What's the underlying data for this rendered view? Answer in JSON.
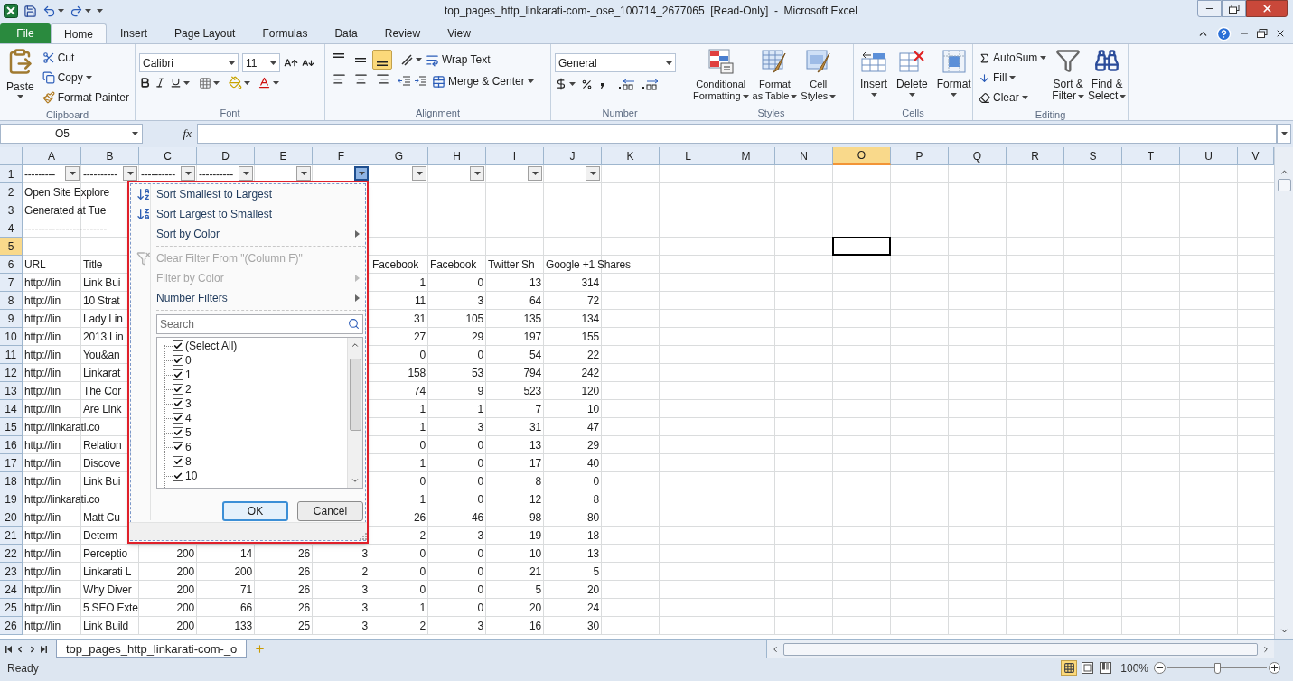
{
  "window": {
    "title": "top_pages_http_linkarati-com-_ose_100714_2677065  [Read-Only]  -  Microsoft Excel"
  },
  "ribbon_tabs": [
    {
      "label": "File",
      "kind": "file",
      "selected": false
    },
    {
      "label": "Home",
      "kind": "tab",
      "selected": true
    },
    {
      "label": "Insert",
      "kind": "tab",
      "selected": false
    },
    {
      "label": "Page Layout",
      "kind": "tab",
      "selected": false
    },
    {
      "label": "Formulas",
      "kind": "tab",
      "selected": false
    },
    {
      "label": "Data",
      "kind": "tab",
      "selected": false
    },
    {
      "label": "Review",
      "kind": "tab",
      "selected": false
    },
    {
      "label": "View",
      "kind": "tab",
      "selected": false
    }
  ],
  "clipboard": {
    "label": "Clipboard",
    "paste": "Paste",
    "cut": "Cut",
    "copy": "Copy",
    "format_painter": "Format Painter"
  },
  "font": {
    "label": "Font",
    "name": "Calibri",
    "size": "11"
  },
  "alignment": {
    "label": "Alignment",
    "wrap_text": "Wrap Text",
    "merge": "Merge & Center",
    "vertical_align": [
      {
        "selected": false
      },
      {
        "selected": false
      },
      {
        "selected": true
      }
    ]
  },
  "number": {
    "label": "Number",
    "format": "General"
  },
  "styles": {
    "label": "Styles",
    "buttons": [
      {
        "lines": [
          "Conditional",
          "Formatting"
        ],
        "kind": "conditional"
      },
      {
        "lines": [
          "Format",
          "as Table"
        ],
        "kind": "table"
      },
      {
        "lines": [
          "Cell",
          "Styles"
        ],
        "kind": "cell"
      }
    ]
  },
  "cells": {
    "label": "Cells",
    "buttons": [
      {
        "label": "Insert",
        "kind": "insert"
      },
      {
        "label": "Delete",
        "kind": "delete"
      },
      {
        "label": "Format",
        "kind": "format"
      }
    ]
  },
  "editing": {
    "label": "Editing",
    "autosum": "AutoSum",
    "fill": "Fill",
    "clear": "Clear",
    "sort": [
      "Sort &",
      "Filter"
    ],
    "find": [
      "Find &",
      "Select"
    ]
  },
  "formula_bar": {
    "name_box": "O5",
    "function_label": "fx"
  },
  "columns": [
    {
      "label": "A",
      "selected": false,
      "filter": true,
      "filter_active": false
    },
    {
      "label": "B",
      "selected": false,
      "filter": true,
      "filter_active": false
    },
    {
      "label": "C",
      "selected": false,
      "filter": true,
      "filter_active": false
    },
    {
      "label": "D",
      "selected": false,
      "filter": true,
      "filter_active": false
    },
    {
      "label": "E",
      "selected": false,
      "filter": true,
      "filter_active": false
    },
    {
      "label": "F",
      "selected": false,
      "filter": true,
      "filter_active": true
    },
    {
      "label": "G",
      "selected": false,
      "filter": true,
      "filter_active": false
    },
    {
      "label": "H",
      "selected": false,
      "filter": true,
      "filter_active": false
    },
    {
      "label": "I",
      "selected": false,
      "filter": true,
      "filter_active": false
    },
    {
      "label": "J",
      "selected": false,
      "filter": true,
      "filter_active": false
    },
    {
      "label": "K",
      "selected": false
    },
    {
      "label": "L",
      "selected": false
    },
    {
      "label": "M",
      "selected": false
    },
    {
      "label": "N",
      "selected": false
    },
    {
      "label": "O",
      "selected": true
    },
    {
      "label": "P",
      "selected": false
    },
    {
      "label": "Q",
      "selected": false
    },
    {
      "label": "R",
      "selected": false
    },
    {
      "label": "S",
      "selected": false
    },
    {
      "label": "T",
      "selected": false
    },
    {
      "label": "U",
      "selected": false
    },
    {
      "label": "V",
      "selected": false
    }
  ],
  "rows": [
    {
      "number": "1",
      "kind": "filter_header",
      "selected": false,
      "a": "---------",
      "b": "----------",
      "c": "----------",
      "d": "----------"
    },
    {
      "number": "2",
      "kind": "text",
      "selected": false,
      "a": "Open Site Explore"
    },
    {
      "number": "3",
      "kind": "text",
      "selected": false,
      "a": "Generated at Tue"
    },
    {
      "number": "4",
      "kind": "text",
      "selected": false,
      "a": "------------------------"
    },
    {
      "number": "5",
      "kind": "text",
      "selected": true
    },
    {
      "number": "6",
      "kind": "text",
      "selected": false,
      "a": "URL",
      "b": "Title",
      "g": "Facebook",
      "h": "Facebook",
      "i": "Twitter Sh",
      "j": "Google +1 Shares"
    },
    {
      "number": "7",
      "kind": "data",
      "selected": false,
      "a": "http://lin",
      "b": "Link Bui",
      "g": "1",
      "h": "0",
      "i": "13",
      "j": "314"
    },
    {
      "number": "8",
      "kind": "data",
      "selected": false,
      "a": "http://lin",
      "b": "10 Strat",
      "g": "11",
      "h": "3",
      "i": "64",
      "j": "72"
    },
    {
      "number": "9",
      "kind": "data",
      "selected": false,
      "a": "http://lin",
      "b": "Lady Lin",
      "g": "31",
      "h": "105",
      "i": "135",
      "j": "134"
    },
    {
      "number": "10",
      "kind": "data",
      "selected": false,
      "a": "http://lin",
      "b": "2013 Lin",
      "g": "27",
      "h": "29",
      "i": "197",
      "j": "155"
    },
    {
      "number": "11",
      "kind": "data",
      "selected": false,
      "a": "http://lin",
      "b": "You&an",
      "g": "0",
      "h": "0",
      "i": "54",
      "j": "22"
    },
    {
      "number": "12",
      "kind": "data",
      "selected": false,
      "a": "http://lin",
      "b": "Linkarat",
      "g": "158",
      "h": "53",
      "i": "794",
      "j": "242"
    },
    {
      "number": "13",
      "kind": "data",
      "selected": false,
      "a": "http://lin",
      "b": "The Cor",
      "g": "74",
      "h": "9",
      "i": "523",
      "j": "120"
    },
    {
      "number": "14",
      "kind": "data",
      "selected": false,
      "a": "http://lin",
      "b": "Are Link",
      "g": "1",
      "h": "1",
      "i": "7",
      "j": "10"
    },
    {
      "number": "15",
      "kind": "data",
      "selected": false,
      "a": "http://linkarati.co",
      "g": "1",
      "h": "3",
      "i": "31",
      "j": "47"
    },
    {
      "number": "16",
      "kind": "data",
      "selected": false,
      "a": "http://lin",
      "b": "Relation",
      "g": "0",
      "h": "0",
      "i": "13",
      "j": "29"
    },
    {
      "number": "17",
      "kind": "data",
      "selected": false,
      "a": "http://lin",
      "b": "Discove",
      "g": "1",
      "h": "0",
      "i": "17",
      "j": "40"
    },
    {
      "number": "18",
      "kind": "data",
      "selected": false,
      "a": "http://lin",
      "b": "Link Bui",
      "g": "0",
      "h": "0",
      "i": "8",
      "j": "0"
    },
    {
      "number": "19",
      "kind": "data",
      "selected": false,
      "a": "http://linkarati.co",
      "g": "1",
      "h": "0",
      "i": "12",
      "j": "8"
    },
    {
      "number": "20",
      "kind": "data",
      "selected": false,
      "a": "http://lin",
      "b": "Matt Cu",
      "g": "26",
      "h": "46",
      "i": "98",
      "j": "80"
    },
    {
      "number": "21",
      "kind": "data",
      "selected": false,
      "a": "http://lin",
      "b": "Determ",
      "g": "2",
      "h": "3",
      "i": "19",
      "j": "18"
    },
    {
      "number": "22",
      "kind": "data",
      "selected": false,
      "a": "http://lin",
      "b": "Perceptio",
      "c": "200",
      "d": "14",
      "e": "26",
      "f": "3",
      "g": "0",
      "h": "0",
      "i": "10",
      "j": "13"
    },
    {
      "number": "23",
      "kind": "data",
      "selected": false,
      "a": "http://lin",
      "b": "Linkarati L",
      "c": "200",
      "d": "200",
      "e": "26",
      "f": "2",
      "g": "0",
      "h": "0",
      "i": "21",
      "j": "5"
    },
    {
      "number": "24",
      "kind": "data",
      "selected": false,
      "a": "http://lin",
      "b": "Why Diver",
      "c": "200",
      "d": "71",
      "e": "26",
      "f": "3",
      "g": "0",
      "h": "0",
      "i": "5",
      "j": "20"
    },
    {
      "number": "25",
      "kind": "data",
      "selected": false,
      "a": "http://lin",
      "b": "5 SEO Exte",
      "c": "200",
      "d": "66",
      "e": "26",
      "f": "3",
      "g": "1",
      "h": "0",
      "i": "20",
      "j": "24"
    },
    {
      "number": "26",
      "kind": "data",
      "selected": false,
      "a": "http://lin",
      "b": "Link Build",
      "c": "200",
      "d": "133",
      "e": "25",
      "f": "3",
      "g": "2",
      "h": "3",
      "i": "16",
      "j": "30"
    }
  ],
  "filter_menu": {
    "items": [
      {
        "label": "Sort Smallest to Largest",
        "kind": "sort_asc",
        "disabled": false,
        "submenu": false
      },
      {
        "label": "Sort Largest to Smallest",
        "kind": "sort_desc",
        "disabled": false,
        "submenu": false
      },
      {
        "label": "Sort by Color",
        "kind": "plain",
        "disabled": false,
        "submenu": true
      },
      {
        "kind": "separator"
      },
      {
        "label": "Clear Filter From \"(Column F)\"",
        "kind": "clear",
        "disabled": true,
        "submenu": false
      },
      {
        "label": "Filter by Color",
        "kind": "plain",
        "disabled": true,
        "submenu": true
      },
      {
        "label": "Number Filters",
        "kind": "plain",
        "disabled": false,
        "submenu": true
      },
      {
        "kind": "separator"
      }
    ],
    "search": {
      "placeholder": "Search"
    },
    "values": [
      {
        "label": "(Select All)",
        "checked": true
      },
      {
        "label": "0",
        "checked": true
      },
      {
        "label": "1",
        "checked": true
      },
      {
        "label": "2",
        "checked": true
      },
      {
        "label": "3",
        "checked": true
      },
      {
        "label": "4",
        "checked": true
      },
      {
        "label": "5",
        "checked": true
      },
      {
        "label": "6",
        "checked": true
      },
      {
        "label": "8",
        "checked": true
      },
      {
        "label": "10",
        "checked": true
      }
    ],
    "buttons": [
      {
        "label": "OK",
        "default": true
      },
      {
        "label": "Cancel",
        "default": false
      }
    ]
  },
  "sheet_tabs": [
    {
      "label": "top_pages_http_linkarati-com-_o",
      "selected": true
    }
  ],
  "status_bar": {
    "text": "Ready",
    "views": [
      {
        "kind": "normal",
        "selected": true
      },
      {
        "kind": "layout",
        "selected": false
      },
      {
        "kind": "break",
        "selected": false
      }
    ],
    "zoom": "100%",
    "zoom_slider": {
      "level": 0.5
    }
  }
}
